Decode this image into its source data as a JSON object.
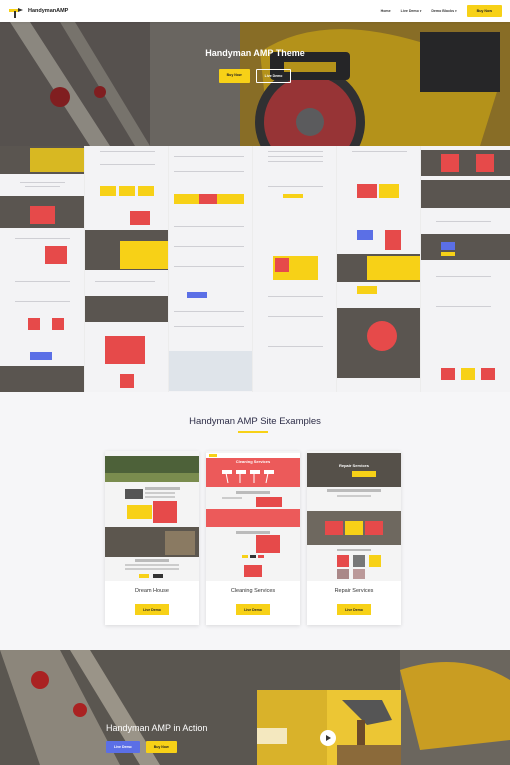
{
  "nav": {
    "brand": "HandymanAMP",
    "links": [
      {
        "label": "Home"
      },
      {
        "label": "Live Demo",
        "caret": "▾"
      },
      {
        "label": "Demo Blocks",
        "caret": "▾"
      }
    ],
    "buy_label": "Buy Now"
  },
  "hero": {
    "title": "Handyman AMP Theme",
    "buy_label": "Buy Now",
    "demo_label": "Live Demo"
  },
  "examples": {
    "title": "Handyman AMP Site Examples",
    "cards": [
      {
        "title": "Dream House",
        "button": "Live Demo",
        "banner": ""
      },
      {
        "title": "Cleaning Services",
        "button": "Live Demo",
        "banner": "Cleaning Services"
      },
      {
        "title": "Repair Services",
        "button": "Live Demo",
        "banner": "Repair Services"
      }
    ]
  },
  "action": {
    "title": "Handyman AMP in Action",
    "demo_label": "Live Demo",
    "buy_label": "Buy Now"
  },
  "colors": {
    "accent": "#f7d117",
    "blue": "#5b6fe6",
    "red": "#e64a4a"
  },
  "icons": {
    "logo": "hammer-logo-icon",
    "play": "play-icon"
  }
}
